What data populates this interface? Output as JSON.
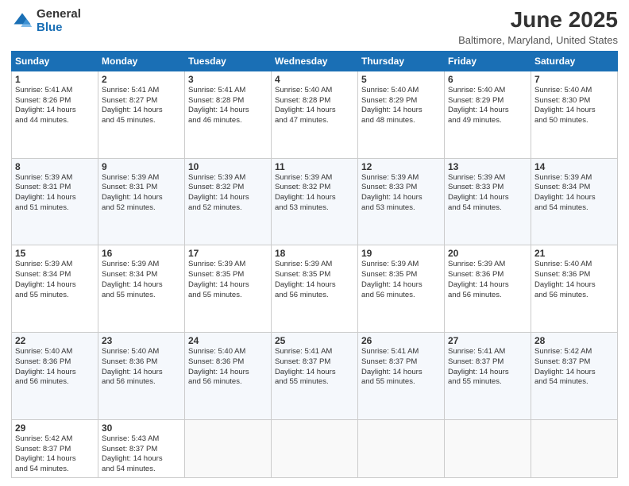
{
  "header": {
    "logo_general": "General",
    "logo_blue": "Blue",
    "month_title": "June 2025",
    "location": "Baltimore, Maryland, United States"
  },
  "days_of_week": [
    "Sunday",
    "Monday",
    "Tuesday",
    "Wednesday",
    "Thursday",
    "Friday",
    "Saturday"
  ],
  "weeks": [
    [
      {
        "day": "1",
        "sunrise": "5:41 AM",
        "sunset": "8:26 PM",
        "daylight": "14 hours and 44 minutes."
      },
      {
        "day": "2",
        "sunrise": "5:41 AM",
        "sunset": "8:27 PM",
        "daylight": "14 hours and 45 minutes."
      },
      {
        "day": "3",
        "sunrise": "5:41 AM",
        "sunset": "8:28 PM",
        "daylight": "14 hours and 46 minutes."
      },
      {
        "day": "4",
        "sunrise": "5:40 AM",
        "sunset": "8:28 PM",
        "daylight": "14 hours and 47 minutes."
      },
      {
        "day": "5",
        "sunrise": "5:40 AM",
        "sunset": "8:29 PM",
        "daylight": "14 hours and 48 minutes."
      },
      {
        "day": "6",
        "sunrise": "5:40 AM",
        "sunset": "8:29 PM",
        "daylight": "14 hours and 49 minutes."
      },
      {
        "day": "7",
        "sunrise": "5:40 AM",
        "sunset": "8:30 PM",
        "daylight": "14 hours and 50 minutes."
      }
    ],
    [
      {
        "day": "8",
        "sunrise": "5:39 AM",
        "sunset": "8:31 PM",
        "daylight": "14 hours and 51 minutes."
      },
      {
        "day": "9",
        "sunrise": "5:39 AM",
        "sunset": "8:31 PM",
        "daylight": "14 hours and 52 minutes."
      },
      {
        "day": "10",
        "sunrise": "5:39 AM",
        "sunset": "8:32 PM",
        "daylight": "14 hours and 52 minutes."
      },
      {
        "day": "11",
        "sunrise": "5:39 AM",
        "sunset": "8:32 PM",
        "daylight": "14 hours and 53 minutes."
      },
      {
        "day": "12",
        "sunrise": "5:39 AM",
        "sunset": "8:33 PM",
        "daylight": "14 hours and 53 minutes."
      },
      {
        "day": "13",
        "sunrise": "5:39 AM",
        "sunset": "8:33 PM",
        "daylight": "14 hours and 54 minutes."
      },
      {
        "day": "14",
        "sunrise": "5:39 AM",
        "sunset": "8:34 PM",
        "daylight": "14 hours and 54 minutes."
      }
    ],
    [
      {
        "day": "15",
        "sunrise": "5:39 AM",
        "sunset": "8:34 PM",
        "daylight": "14 hours and 55 minutes."
      },
      {
        "day": "16",
        "sunrise": "5:39 AM",
        "sunset": "8:34 PM",
        "daylight": "14 hours and 55 minutes."
      },
      {
        "day": "17",
        "sunrise": "5:39 AM",
        "sunset": "8:35 PM",
        "daylight": "14 hours and 55 minutes."
      },
      {
        "day": "18",
        "sunrise": "5:39 AM",
        "sunset": "8:35 PM",
        "daylight": "14 hours and 56 minutes."
      },
      {
        "day": "19",
        "sunrise": "5:39 AM",
        "sunset": "8:35 PM",
        "daylight": "14 hours and 56 minutes."
      },
      {
        "day": "20",
        "sunrise": "5:39 AM",
        "sunset": "8:36 PM",
        "daylight": "14 hours and 56 minutes."
      },
      {
        "day": "21",
        "sunrise": "5:40 AM",
        "sunset": "8:36 PM",
        "daylight": "14 hours and 56 minutes."
      }
    ],
    [
      {
        "day": "22",
        "sunrise": "5:40 AM",
        "sunset": "8:36 PM",
        "daylight": "14 hours and 56 minutes."
      },
      {
        "day": "23",
        "sunrise": "5:40 AM",
        "sunset": "8:36 PM",
        "daylight": "14 hours and 56 minutes."
      },
      {
        "day": "24",
        "sunrise": "5:40 AM",
        "sunset": "8:36 PM",
        "daylight": "14 hours and 56 minutes."
      },
      {
        "day": "25",
        "sunrise": "5:41 AM",
        "sunset": "8:37 PM",
        "daylight": "14 hours and 55 minutes."
      },
      {
        "day": "26",
        "sunrise": "5:41 AM",
        "sunset": "8:37 PM",
        "daylight": "14 hours and 55 minutes."
      },
      {
        "day": "27",
        "sunrise": "5:41 AM",
        "sunset": "8:37 PM",
        "daylight": "14 hours and 55 minutes."
      },
      {
        "day": "28",
        "sunrise": "5:42 AM",
        "sunset": "8:37 PM",
        "daylight": "14 hours and 54 minutes."
      }
    ],
    [
      {
        "day": "29",
        "sunrise": "5:42 AM",
        "sunset": "8:37 PM",
        "daylight": "14 hours and 54 minutes."
      },
      {
        "day": "30",
        "sunrise": "5:43 AM",
        "sunset": "8:37 PM",
        "daylight": "14 hours and 54 minutes."
      },
      null,
      null,
      null,
      null,
      null
    ]
  ]
}
